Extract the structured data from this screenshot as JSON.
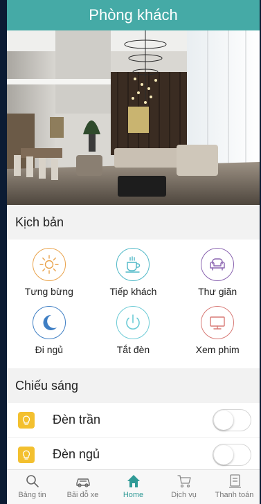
{
  "header": {
    "title": "Phòng khách"
  },
  "scenes_section": {
    "title": "Kịch bản",
    "items": [
      {
        "label": "Tưng bừng",
        "icon": "sun-icon",
        "color": "#e9a24a"
      },
      {
        "label": "Tiếp khách",
        "icon": "coffee-cup-icon",
        "color": "#4fb8c7"
      },
      {
        "label": "Thư giãn",
        "icon": "armchair-icon",
        "color": "#8a64b0"
      },
      {
        "label": "Đi ngủ",
        "icon": "moon-icon",
        "color": "#3f7fc4"
      },
      {
        "label": "Tắt đèn",
        "icon": "power-icon",
        "color": "#6ccbd6"
      },
      {
        "label": "Xem phim",
        "icon": "monitor-icon",
        "color": "#d87a76"
      }
    ]
  },
  "lighting_section": {
    "title": "Chiếu sáng",
    "items": [
      {
        "label": "Đèn trần",
        "on": false
      },
      {
        "label": "Đèn ngủ",
        "on": false
      }
    ]
  },
  "tabbar": {
    "tabs": [
      {
        "label": "Bảng tin",
        "icon": "search-icon"
      },
      {
        "label": "Bãi đỗ xe",
        "icon": "car-icon"
      },
      {
        "label": "Home",
        "icon": "home-icon",
        "active": true
      },
      {
        "label": "Dịch vụ",
        "icon": "cart-icon"
      },
      {
        "label": "Thanh toán",
        "icon": "receipt-icon"
      }
    ]
  },
  "colors": {
    "accent": "#45aaa6",
    "bulb": "#f3c02f"
  }
}
